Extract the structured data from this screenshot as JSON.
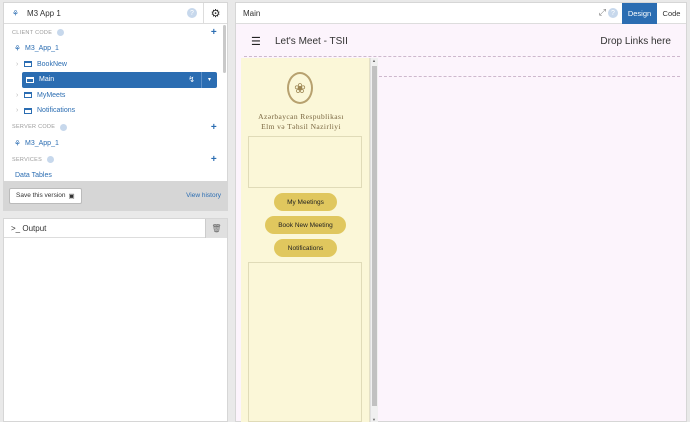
{
  "left_panel": {
    "app_title": "M3 App 1",
    "client_code_label": "CLIENT CODE",
    "client_app": "M3_App_1",
    "forms": [
      {
        "label": "BookNew"
      },
      {
        "label": "Main"
      },
      {
        "label": "MyMeets"
      },
      {
        "label": "Notifications"
      }
    ],
    "server_code_label": "SERVER CODE",
    "server_app": "M3_App_1",
    "services_label": "SERVICES",
    "data_tables": "Data Tables",
    "save_label": "Save this version",
    "view_history": "View history"
  },
  "output_panel": {
    "title": ">_ Output"
  },
  "right_panel": {
    "title": "Main",
    "tab_design": "Design",
    "tab_code": "Code",
    "page_title": "Let's Meet - TSII",
    "drop_links": "Drop Links here",
    "org_line1": "Azərbaycan Respublikası",
    "org_line2": "Elm və Təhsil Nazirliyi",
    "btn_my_meetings": "My Meetings",
    "btn_book": "Book New Meeting",
    "btn_notifications": "Notifications"
  },
  "colors": {
    "accent": "#2b6db2",
    "pill": "#e0c75e",
    "sidebar_bg": "#fbf7d8",
    "canvas_bg": "#fcf4fc"
  }
}
